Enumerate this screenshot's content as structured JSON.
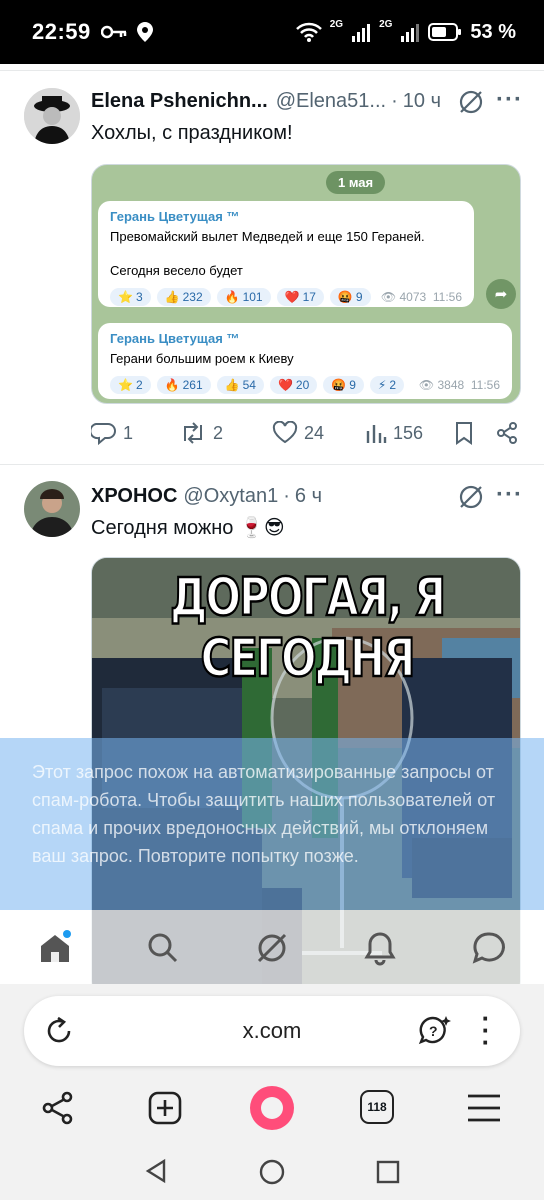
{
  "status": {
    "time": "22:59",
    "battery": "53 %",
    "net1": "2G",
    "net2": "2G"
  },
  "post1": {
    "name": "Elena Pshenichn...",
    "handle": "@Elena51...",
    "sep": "·",
    "ago": "10 ч",
    "text": "Хохлы, с праздником!",
    "tg": {
      "date": "1 мая",
      "msg1": {
        "from": "Герань Цветущая ™",
        "line1": "Превомайский вылет Медведей и еще 150 Гераней.",
        "line2": "Сегодня весело будет",
        "reactions": [
          {
            "emoji": "⭐",
            "count": "3"
          },
          {
            "emoji": "👍",
            "count": "232"
          },
          {
            "emoji": "🔥",
            "count": "101"
          },
          {
            "emoji": "❤️",
            "count": "17"
          },
          {
            "emoji": "🤬",
            "count": "9"
          }
        ],
        "views": "4073",
        "time": "11:56"
      },
      "msg2": {
        "from": "Герань Цветущая ™",
        "line1": "Герани большим роем к Киеву",
        "reactions": [
          {
            "emoji": "⭐",
            "count": "2"
          },
          {
            "emoji": "🔥",
            "count": "261"
          },
          {
            "emoji": "👍",
            "count": "54"
          },
          {
            "emoji": "❤️",
            "count": "20"
          },
          {
            "emoji": "🤬",
            "count": "9"
          },
          {
            "emoji": "⚡",
            "count": "2"
          }
        ],
        "views": "3848",
        "time": "11:56"
      }
    },
    "replies": "1",
    "reposts": "2",
    "likes": "24",
    "views": "156"
  },
  "post2": {
    "name": "ХРОНОС",
    "handle": "@Oxytan1",
    "sep": "·",
    "ago": "6 ч",
    "text": "Сегодня можно 🍷😎",
    "meme_caption": "ДОРОГАЯ, Я СЕГОДНЯ"
  },
  "banner": {
    "text": "Этот запрос похож на автоматизированные запросы от спам-робота. Чтобы защитить наших пользователей от спама и прочих вредоносных действий, мы отклоняем ваш запрос. Повторите попытку позже."
  },
  "browser": {
    "url": "x.com",
    "tabs_count": "118"
  },
  "colors": {
    "accent": "#1d9bf0",
    "tg_green": "#a9c59a",
    "alice": "#ff4d7a"
  }
}
